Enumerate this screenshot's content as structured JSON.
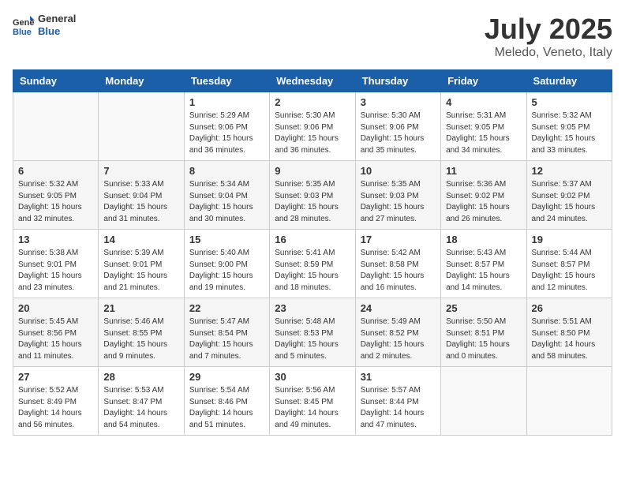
{
  "header": {
    "logo_line1": "General",
    "logo_line2": "Blue",
    "month": "July 2025",
    "location": "Meledo, Veneto, Italy"
  },
  "weekdays": [
    "Sunday",
    "Monday",
    "Tuesday",
    "Wednesday",
    "Thursday",
    "Friday",
    "Saturday"
  ],
  "weeks": [
    [
      {
        "day": "",
        "empty": true
      },
      {
        "day": "",
        "empty": true
      },
      {
        "day": "1",
        "info": "Sunrise: 5:29 AM\nSunset: 9:06 PM\nDaylight: 15 hours and 36 minutes."
      },
      {
        "day": "2",
        "info": "Sunrise: 5:30 AM\nSunset: 9:06 PM\nDaylight: 15 hours and 36 minutes."
      },
      {
        "day": "3",
        "info": "Sunrise: 5:30 AM\nSunset: 9:06 PM\nDaylight: 15 hours and 35 minutes."
      },
      {
        "day": "4",
        "info": "Sunrise: 5:31 AM\nSunset: 9:05 PM\nDaylight: 15 hours and 34 minutes."
      },
      {
        "day": "5",
        "info": "Sunrise: 5:32 AM\nSunset: 9:05 PM\nDaylight: 15 hours and 33 minutes."
      }
    ],
    [
      {
        "day": "6",
        "info": "Sunrise: 5:32 AM\nSunset: 9:05 PM\nDaylight: 15 hours and 32 minutes."
      },
      {
        "day": "7",
        "info": "Sunrise: 5:33 AM\nSunset: 9:04 PM\nDaylight: 15 hours and 31 minutes."
      },
      {
        "day": "8",
        "info": "Sunrise: 5:34 AM\nSunset: 9:04 PM\nDaylight: 15 hours and 30 minutes."
      },
      {
        "day": "9",
        "info": "Sunrise: 5:35 AM\nSunset: 9:03 PM\nDaylight: 15 hours and 28 minutes."
      },
      {
        "day": "10",
        "info": "Sunrise: 5:35 AM\nSunset: 9:03 PM\nDaylight: 15 hours and 27 minutes."
      },
      {
        "day": "11",
        "info": "Sunrise: 5:36 AM\nSunset: 9:02 PM\nDaylight: 15 hours and 26 minutes."
      },
      {
        "day": "12",
        "info": "Sunrise: 5:37 AM\nSunset: 9:02 PM\nDaylight: 15 hours and 24 minutes."
      }
    ],
    [
      {
        "day": "13",
        "info": "Sunrise: 5:38 AM\nSunset: 9:01 PM\nDaylight: 15 hours and 23 minutes."
      },
      {
        "day": "14",
        "info": "Sunrise: 5:39 AM\nSunset: 9:01 PM\nDaylight: 15 hours and 21 minutes."
      },
      {
        "day": "15",
        "info": "Sunrise: 5:40 AM\nSunset: 9:00 PM\nDaylight: 15 hours and 19 minutes."
      },
      {
        "day": "16",
        "info": "Sunrise: 5:41 AM\nSunset: 8:59 PM\nDaylight: 15 hours and 18 minutes."
      },
      {
        "day": "17",
        "info": "Sunrise: 5:42 AM\nSunset: 8:58 PM\nDaylight: 15 hours and 16 minutes."
      },
      {
        "day": "18",
        "info": "Sunrise: 5:43 AM\nSunset: 8:57 PM\nDaylight: 15 hours and 14 minutes."
      },
      {
        "day": "19",
        "info": "Sunrise: 5:44 AM\nSunset: 8:57 PM\nDaylight: 15 hours and 12 minutes."
      }
    ],
    [
      {
        "day": "20",
        "info": "Sunrise: 5:45 AM\nSunset: 8:56 PM\nDaylight: 15 hours and 11 minutes."
      },
      {
        "day": "21",
        "info": "Sunrise: 5:46 AM\nSunset: 8:55 PM\nDaylight: 15 hours and 9 minutes."
      },
      {
        "day": "22",
        "info": "Sunrise: 5:47 AM\nSunset: 8:54 PM\nDaylight: 15 hours and 7 minutes."
      },
      {
        "day": "23",
        "info": "Sunrise: 5:48 AM\nSunset: 8:53 PM\nDaylight: 15 hours and 5 minutes."
      },
      {
        "day": "24",
        "info": "Sunrise: 5:49 AM\nSunset: 8:52 PM\nDaylight: 15 hours and 2 minutes."
      },
      {
        "day": "25",
        "info": "Sunrise: 5:50 AM\nSunset: 8:51 PM\nDaylight: 15 hours and 0 minutes."
      },
      {
        "day": "26",
        "info": "Sunrise: 5:51 AM\nSunset: 8:50 PM\nDaylight: 14 hours and 58 minutes."
      }
    ],
    [
      {
        "day": "27",
        "info": "Sunrise: 5:52 AM\nSunset: 8:49 PM\nDaylight: 14 hours and 56 minutes."
      },
      {
        "day": "28",
        "info": "Sunrise: 5:53 AM\nSunset: 8:47 PM\nDaylight: 14 hours and 54 minutes."
      },
      {
        "day": "29",
        "info": "Sunrise: 5:54 AM\nSunset: 8:46 PM\nDaylight: 14 hours and 51 minutes."
      },
      {
        "day": "30",
        "info": "Sunrise: 5:56 AM\nSunset: 8:45 PM\nDaylight: 14 hours and 49 minutes."
      },
      {
        "day": "31",
        "info": "Sunrise: 5:57 AM\nSunset: 8:44 PM\nDaylight: 14 hours and 47 minutes."
      },
      {
        "day": "",
        "empty": true
      },
      {
        "day": "",
        "empty": true
      }
    ]
  ]
}
